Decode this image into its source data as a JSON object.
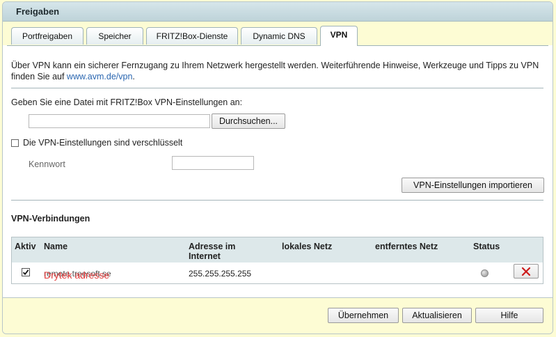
{
  "page_title": "Freigaben",
  "tabs": [
    {
      "label": "Portfreigaben",
      "active": false
    },
    {
      "label": "Speicher",
      "active": false
    },
    {
      "label": "FRITZ!Box-Dienste",
      "active": false
    },
    {
      "label": "Dynamic DNS",
      "active": false
    },
    {
      "label": "VPN",
      "active": true
    }
  ],
  "intro": {
    "text": "Über VPN kann ein sicherer Fernzugang zu Ihrem Netzwerk hergestellt werden. Weiterführende Hinweise, Werkzeuge und Tipps zu VPN finden Sie auf ",
    "link": "www.avm.de/vpn",
    "suffix": "."
  },
  "file_import": {
    "label": "Geben Sie eine Datei mit FRITZ!Box VPN-Einstellungen an:",
    "value": "",
    "browse_label": "Durchsuchen..."
  },
  "encrypted": {
    "label": "Die VPN-Einstellungen sind verschlüsselt",
    "checked": false,
    "password_label": "Kennwort",
    "password_value": ""
  },
  "import_button": "VPN-Einstellungen importieren",
  "connections": {
    "title": "VPN-Verbindungen",
    "columns": [
      "Aktiv",
      "Name",
      "Adresse im Internet",
      "lokales Netz",
      "entferntes Netz",
      "Status"
    ],
    "rows": [
      {
        "active": true,
        "name": "remote.treesoft.se",
        "address": "255.255.255.255",
        "local_net": "",
        "remote_net": "",
        "status": "inactive",
        "overlay_text": "Drytek adresse"
      }
    ]
  },
  "footer": {
    "apply": "Übernehmen",
    "refresh": "Aktualisieren",
    "help": "Hilfe"
  },
  "colors": {
    "background": "#fdfcd4",
    "titlebar": "#c9dce1",
    "table_header": "#dde8ea",
    "link": "#2a66b0",
    "delete_icon": "#cc1a1a",
    "overlay_text": "#e23a3a"
  }
}
